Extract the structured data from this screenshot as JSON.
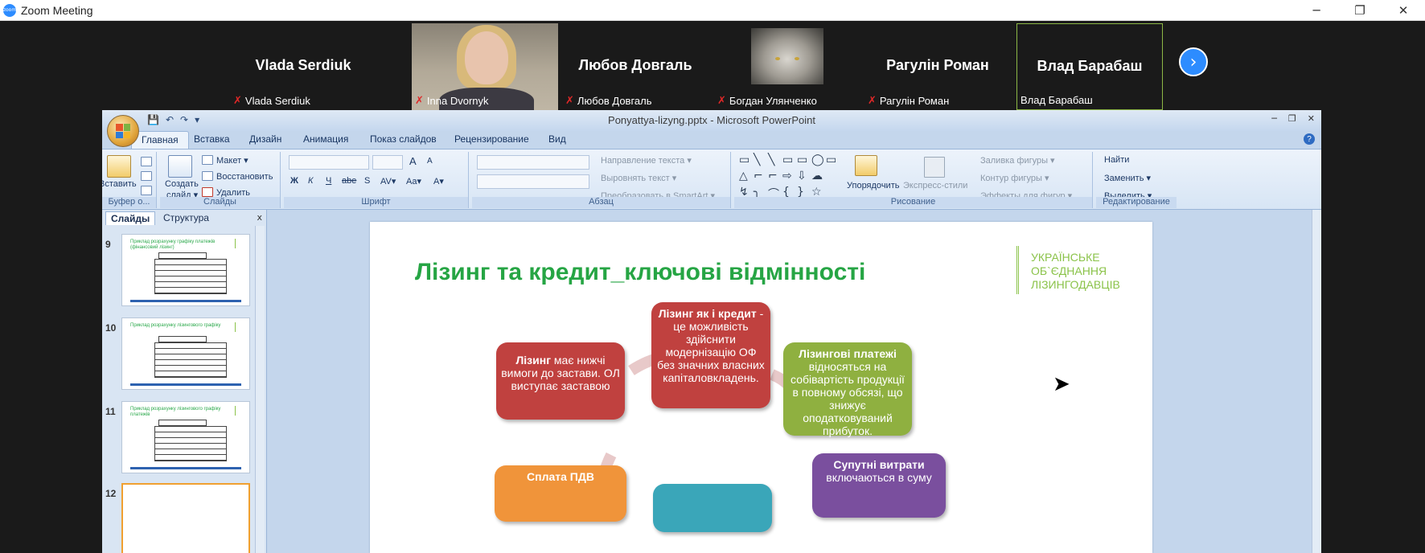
{
  "zoom": {
    "title": "Zoom Meeting",
    "logo_text": "zoom",
    "ctrl_min": "─",
    "ctrl_restore": "❐",
    "ctrl_close": "✕",
    "next_icon": "›",
    "participants": [
      {
        "display": "Vlada Serdiuk",
        "label": "Vlada Serdiuk",
        "muted": true
      },
      {
        "display": "",
        "label": "Inna Dvornyk",
        "muted": true
      },
      {
        "display": "Любов Довгаль",
        "label": "Любов Довгаль",
        "muted": true
      },
      {
        "display": "",
        "label": "Богдан Улянченко",
        "muted": true
      },
      {
        "display": "Рагулін Роман",
        "label": "Рагулін Роман",
        "muted": true
      },
      {
        "display": "Влад Барабаш",
        "label": "Влад Барабаш",
        "muted": false
      }
    ],
    "mic_icon": "✗"
  },
  "ppt": {
    "doc_title": "Ponyattya-lizyng.pptx - Microsoft PowerPoint",
    "qat": [
      "💾",
      "↶",
      "↷",
      "▾"
    ],
    "win_ctrls": [
      "─",
      "❐",
      "✕"
    ],
    "help": "?",
    "tabs": [
      "Главная",
      "Вставка",
      "Дизайн",
      "Анимация",
      "Показ слайдов",
      "Рецензирование",
      "Вид"
    ],
    "ribbon": {
      "paste": "Вставить",
      "create_slide": "Создать",
      "create_slide2": "слайд ▾",
      "layout": "Макет ▾",
      "reset": "Восстановить",
      "delete": "Удалить",
      "text_direction": "Направление текста ▾",
      "align_text": "Выровнять текст ▾",
      "convert_smartart": "Преобразовать в SmartArt ▾",
      "arrange": "Упорядочить",
      "quick_styles": "Экспресс-стили",
      "shape_fill": "Заливка фигуры ▾",
      "shape_outline": "Контур фигуры ▾",
      "shape_effects": "Эффекты для фигур ▾",
      "find": "Найти",
      "replace": "Заменить ▾",
      "select": "Выделить ▾",
      "font_buttons": [
        "Ж",
        "К",
        "Ч",
        "abe",
        "S",
        "AV▾",
        "Aa▾",
        "A▾"
      ],
      "grow_font": "A",
      "shrink_font": "A",
      "shapes": [
        "▭",
        "╲",
        "╲",
        "▭",
        "▭",
        "◯",
        "▭",
        "△",
        "⌐",
        "⌐",
        "⇨",
        "⇩",
        "☁",
        "↯",
        "╮",
        "⌒",
        "{",
        "}",
        "☆"
      ],
      "groups": [
        "Буфер о...",
        "Слайды",
        "Шрифт",
        "Абзац",
        "Рисование",
        "Редактирование"
      ]
    },
    "side_tabs": [
      "Слайды",
      "Структура"
    ],
    "side_close": "x",
    "thumbs": [
      {
        "num": "9",
        "title": "Приклад розрахунку графіку платежів (фінансовий лізинг)"
      },
      {
        "num": "10",
        "title": "Приклад розрахунку лізингового графіку"
      },
      {
        "num": "11",
        "title": "Приклад розрахунку лізингового графіку платежів"
      },
      {
        "num": "12",
        "title": ""
      }
    ],
    "slide": {
      "title": "Лізинг та кредит_ключові відмінності",
      "logo": [
        "УКРАЇНСЬКЕ",
        "ОБ`ЄДНАННЯ",
        "ЛІЗИНГОДАВЦІВ"
      ],
      "box_top_bold": "Лізинг як і кредит",
      "box_top_rest": "- це можливість здійснити модернізацію ОФ без значних власних капіталовкладень.",
      "box_left_bold": "Лізинг",
      "box_left_rest": " має нижчі вимоги до застави. ОЛ виступає заставою",
      "box_right_bold": "Лізингові платежі",
      "box_right_rest": "відносяться на собівартість продукції в повному обсязі, що знижує оподатковуваний прибуток.",
      "box_br_bold": "Супутні витрати",
      "box_br_rest": "включаються в суму",
      "box_bl_partial": "Сплата ПДВ",
      "colors": {
        "red": "#c0413f",
        "green": "#8fb040",
        "purple": "#7a4f9e",
        "orange": "#f0943a",
        "teal": "#3aa6b9",
        "title": "#26a544",
        "logo": "#8bc34a"
      }
    }
  },
  "cursor_icon": "➤"
}
